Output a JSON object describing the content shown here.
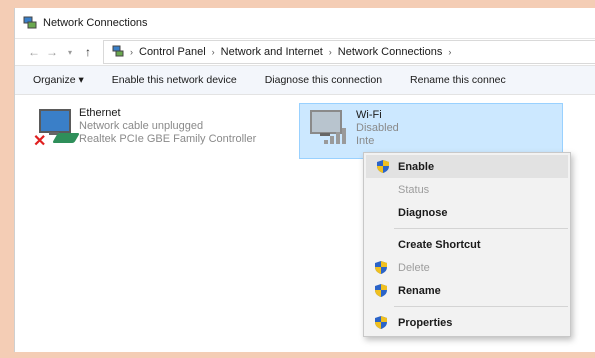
{
  "window": {
    "title": "Network Connections"
  },
  "address": {
    "crumbs": [
      "Control Panel",
      "Network and Internet",
      "Network Connections"
    ]
  },
  "toolbar": {
    "organize": "Organize ▾",
    "enable_device": "Enable this network device",
    "diagnose": "Diagnose this connection",
    "rename": "Rename this connec"
  },
  "connections": [
    {
      "name": "Ethernet",
      "status": "Network cable unplugged",
      "adapter": "Realtek PCIe GBE Family Controller"
    },
    {
      "name": "Wi-Fi",
      "status": "Disabled",
      "adapter": "Inte"
    }
  ],
  "menu": {
    "enable": "Enable",
    "status": "Status",
    "diagnose": "Diagnose",
    "create_shortcut": "Create Shortcut",
    "delete": "Delete",
    "rename": "Rename",
    "properties": "Properties"
  },
  "colors": {
    "background": "#f4cdb5",
    "selection": "#cce8ff",
    "accent": "#3a7fc8"
  }
}
